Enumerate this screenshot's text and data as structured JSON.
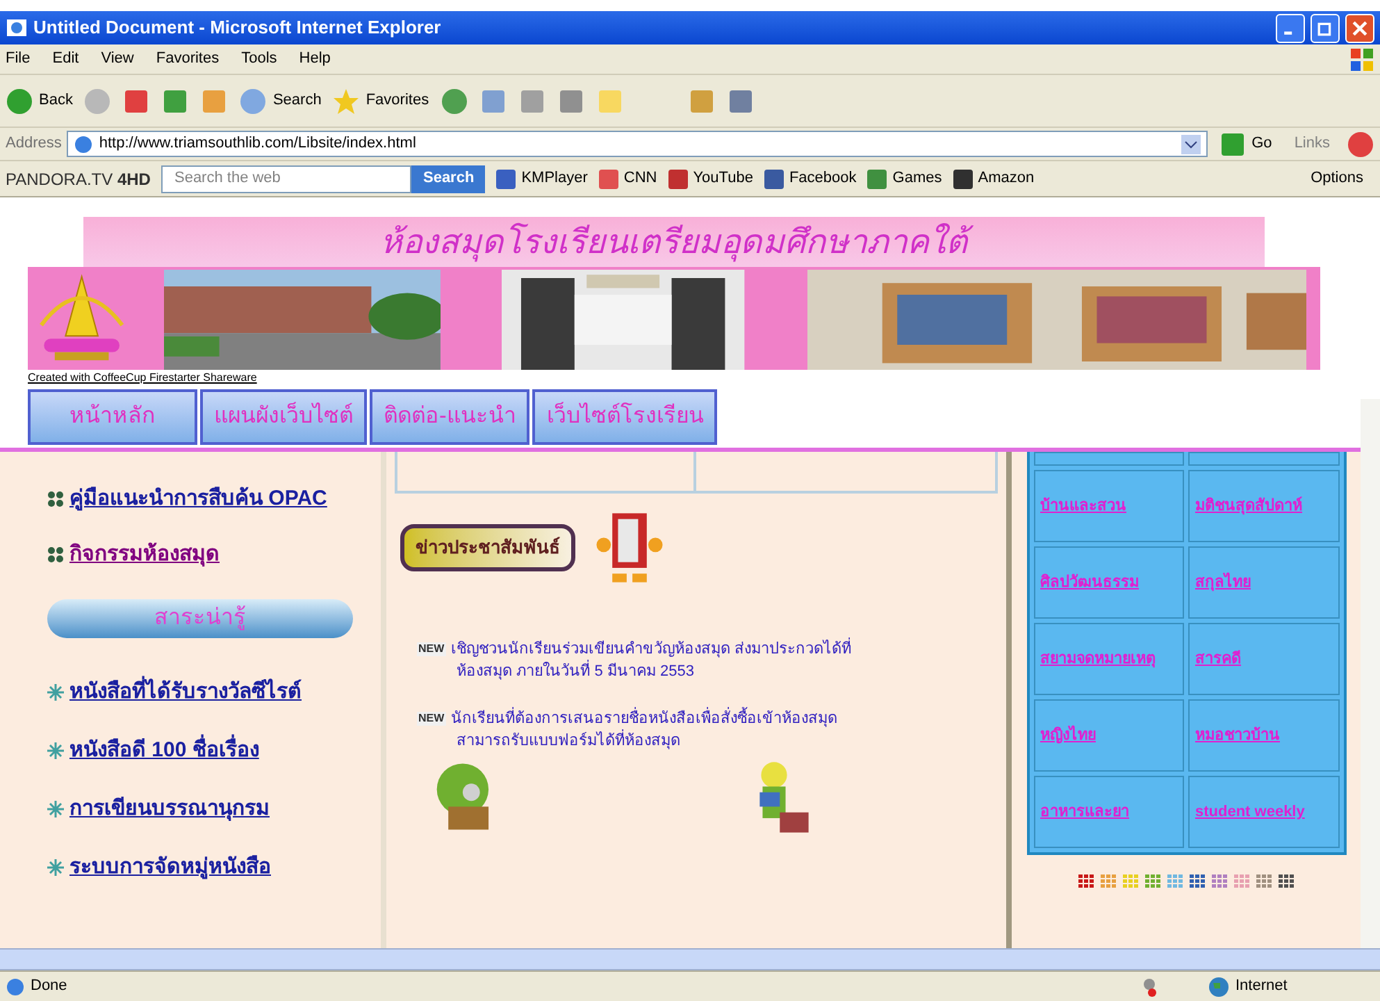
{
  "window": {
    "title": "Untitled Document - Microsoft Internet Explorer"
  },
  "menu": [
    "File",
    "Edit",
    "View",
    "Favorites",
    "Tools",
    "Help"
  ],
  "toolbar": {
    "back": "Back",
    "search": "Search",
    "favorites": "Favorites"
  },
  "address_bar": {
    "label": "Address",
    "url": "http://www.triamsouthlib.com/Libsite/index.html",
    "go": "Go",
    "links": "Links"
  },
  "search_toolbar": {
    "brand": "PANDORA.TV",
    "brand_suffix": "4HD",
    "placeholder": "Search the web",
    "button": "Search",
    "bookmarks": [
      "KMPlayer",
      "CNN",
      "YouTube",
      "Facebook",
      "Games",
      "Amazon"
    ],
    "options": "Options"
  },
  "page": {
    "banner_title": "ห้องสมุดโรงเรียนเตรียมอุดมศึกษาภาคใต้",
    "credit": "Created with CoffeeCup Firestarter Shareware",
    "nav": [
      "หน้าหลัก",
      "แผนผังเว็บไซต์",
      "ติดต่อ-แนะนำ",
      "เว็บไซต์โรงเรียน"
    ],
    "left_links": [
      "คู่มือแนะนำการสืบค้น OPAC",
      "กิจกรรมห้องสมุด"
    ],
    "section_header": "สาระน่ารู้",
    "section_links": [
      "หนังสือที่ได้รับรางวัลซีไรต์",
      "หนังสือดี 100 ชื่อเรื่อง",
      "การเขียนบรรณานุกรม",
      "ระบบการจัดหมู่หนังสือ"
    ],
    "news_header": "ข่าวประชาสัมพันธ์",
    "news": [
      {
        "badge": "NEW",
        "lines": [
          "เชิญชวนนักเรียนร่วมเขียนคำขวัญห้องสมุด ส่งมาประกวดได้ที่",
          "ห้องสมุด ภายในวันที่ 5 มีนาคม 2553"
        ]
      },
      {
        "badge": "NEW",
        "lines": [
          "นักเรียนที่ต้องการเสนอรายชื่อหนังสือเพื่อสั่งซื้อเข้าห้องสมุด",
          "สามารถรับแบบฟอร์มได้ที่ห้องสมุด"
        ]
      }
    ],
    "magazines": [
      "บ้านและสวน",
      "มติชนสุดสัปดาห์",
      "ศิลปวัฒนธรรม",
      "สกุลไทย",
      "สยามจดหมายเหตุ",
      "สารคดี",
      "หญิงไทย",
      "หมอชาวบ้าน",
      "อาหารและยา",
      "student weekly"
    ],
    "swatches": [
      {
        "color": "#c81818"
      },
      {
        "color": "#e8a040"
      },
      {
        "color": "#e8d020"
      },
      {
        "color": "#70b030"
      },
      {
        "color": "#70b8e0"
      },
      {
        "color": "#3060b0"
      },
      {
        "color": "#b080c0"
      },
      {
        "color": "#e8a0b0"
      },
      {
        "color": "#a09080"
      },
      {
        "color": "#505050"
      }
    ]
  },
  "status_bar": {
    "text": "Done",
    "zone": "Internet"
  }
}
